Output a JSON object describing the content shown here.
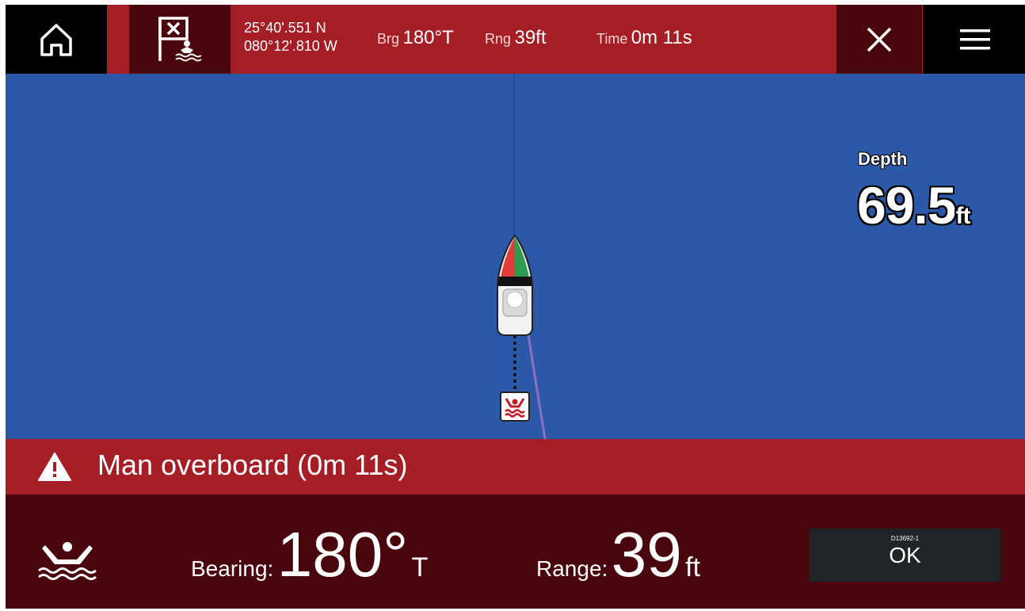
{
  "topbar": {
    "latitude": "25°40'.551 N",
    "longitude": "080°12'.810 W",
    "bearing_label": "Brg",
    "bearing_value": "180°T",
    "range_label": "Rng",
    "range_value": "39ft",
    "time_label": "Time",
    "time_value": "0m 11s",
    "icons": {
      "home": "home-icon",
      "mob_flag": "mob-flag-icon",
      "close": "close-icon",
      "menu": "hamburger-menu-icon"
    }
  },
  "map": {
    "depth_label": "Depth",
    "depth_value": "69.5",
    "depth_unit": "ft",
    "icons": {
      "vessel": "vessel-icon",
      "mob_marker": "mob-marker-icon"
    }
  },
  "alarm": {
    "message": "Man overboard (0m 11s)",
    "icon": "warning-icon"
  },
  "panel": {
    "icon": "swimmer-icon",
    "bearing_label": "Bearing:",
    "bearing_value": "180°",
    "bearing_unit": "T",
    "range_label": "Range:",
    "range_value": "39",
    "range_unit": "ft",
    "ok_ref": "D13692-1",
    "ok_label": "OK"
  },
  "colors": {
    "alarm_red": "#a61e25",
    "dark_red": "#4a060d",
    "water_blue": "#2b59a8",
    "button_dark": "#1f2426"
  }
}
